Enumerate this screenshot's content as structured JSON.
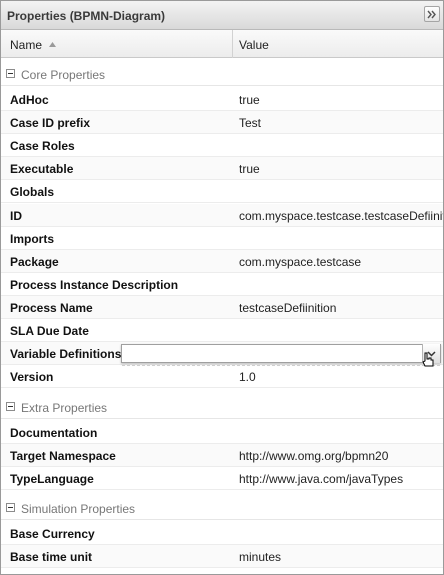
{
  "panel": {
    "title": "Properties (BPMN-Diagram)",
    "collapse_icon": "double-chevron-right-icon"
  },
  "columns": {
    "name": "Name",
    "value": "Value",
    "sort_icon": "sort-ascending-icon"
  },
  "groups": [
    {
      "label": "Core Properties",
      "rows": [
        {
          "name": "AdHoc",
          "value": "true"
        },
        {
          "name": "Case ID prefix",
          "value": "Test"
        },
        {
          "name": "Case Roles",
          "value": ""
        },
        {
          "name": "Executable",
          "value": "true"
        },
        {
          "name": "Globals",
          "value": ""
        },
        {
          "name": "ID",
          "value": "com.myspace.testcase.testcaseDefiinition"
        },
        {
          "name": "Imports",
          "value": ""
        },
        {
          "name": "Package",
          "value": "com.myspace.testcase"
        },
        {
          "name": "Process Instance Description",
          "value": ""
        },
        {
          "name": "Process Name",
          "value": "testcaseDefiinition"
        },
        {
          "name": "SLA Due Date",
          "value": ""
        },
        {
          "name": "Variable Definitions",
          "value": ""
        },
        {
          "name": "Version",
          "value": "1.0"
        }
      ]
    },
    {
      "label": "Extra Properties",
      "rows": [
        {
          "name": "Documentation",
          "value": ""
        },
        {
          "name": "Target Namespace",
          "value": "http://www.omg.org/bpmn20"
        },
        {
          "name": "TypeLanguage",
          "value": "http://www.java.com/javaTypes"
        }
      ]
    },
    {
      "label": "Simulation Properties",
      "rows": [
        {
          "name": "Base Currency",
          "value": ""
        },
        {
          "name": "Base time unit",
          "value": "minutes"
        }
      ]
    }
  ],
  "editor": {
    "value": "",
    "trigger_icon": "chevron-down-icon"
  }
}
